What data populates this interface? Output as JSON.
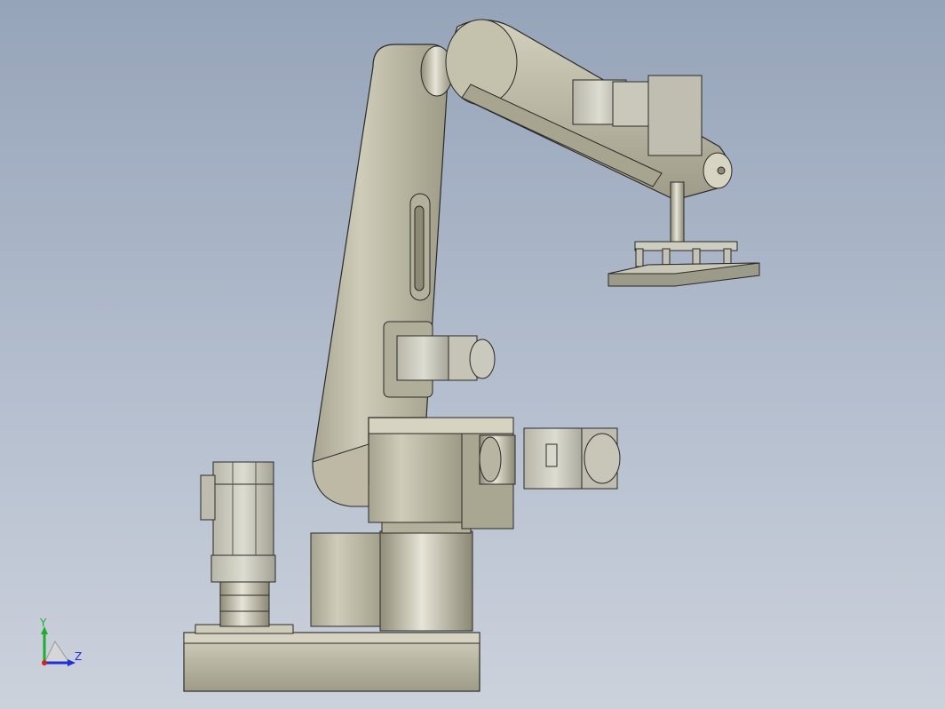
{
  "viewport": {
    "background_top": "#96a4b9",
    "background_bottom": "#ccd2dc"
  },
  "model": {
    "description_icon": "robot-arm-model",
    "colors": {
      "body": "#c9c6b4",
      "body_dark": "#a9a690",
      "motor": "#c4c3b6",
      "edge": "#2a2a28"
    }
  },
  "triad": {
    "y_label": "Y",
    "z_label": "Z",
    "x_color": "#d81e1e",
    "y_color": "#1fae2a",
    "z_color": "#1f2fd8"
  }
}
